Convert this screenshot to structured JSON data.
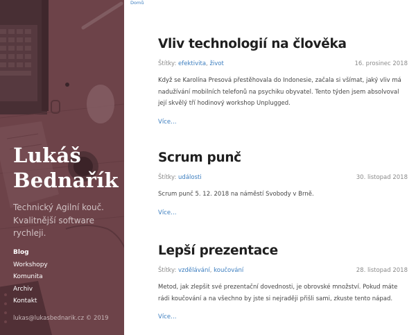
{
  "breadcrumb": {
    "home": "Domů"
  },
  "sidebar": {
    "name_line1": "Lukáš",
    "name_line2": "Bednařík",
    "tagline": "Technický Agilní kouč. Kvalitnější software rychleji.",
    "nav": [
      {
        "label": "Blog",
        "active": true
      },
      {
        "label": "Workshopy",
        "active": false
      },
      {
        "label": "Komunita",
        "active": false
      },
      {
        "label": "Archiv",
        "active": false
      },
      {
        "label": "Kontakt",
        "active": false
      }
    ],
    "footer": "lukas@lukasbednarik.cz © 2019"
  },
  "posts": [
    {
      "title": "Vliv technologií na člověka",
      "tags_label": "Štítky:",
      "tags": [
        "efektivita",
        "život"
      ],
      "date": "16. prosinec 2018",
      "excerpt": "Když se Karolína Presová přestěhovala do Indonesie, začala si všímat, jaký vliv má nadužívání mobilních telefonů na psychiku obyvatel. Tento týden jsem absolvoval její skvělý tří hodinový workshop Unplugged.",
      "more": "Více…"
    },
    {
      "title": "Scrum punč",
      "tags_label": "Štítky:",
      "tags": [
        "události"
      ],
      "date": "30. listopad 2018",
      "excerpt": "Scrum punč 5. 12. 2018 na náměstí Svobody v Brně.",
      "more": "Více…"
    },
    {
      "title": "Lepší prezentace",
      "tags_label": "Štítky:",
      "tags": [
        "vzdělávání",
        "koučování"
      ],
      "date": "28. listopad 2018",
      "excerpt": "Metod, jak zlepšit své prezentační dovednosti, je obrovské množství. Pokud máte rádi koučování a na všechno by jste si nejraději přišli sami, zkuste tento nápad.",
      "more": "Více…"
    }
  ],
  "colors": {
    "sidebar_bg": "#6a4449",
    "link": "#3b7dbf",
    "title": "#1f1f1f"
  }
}
